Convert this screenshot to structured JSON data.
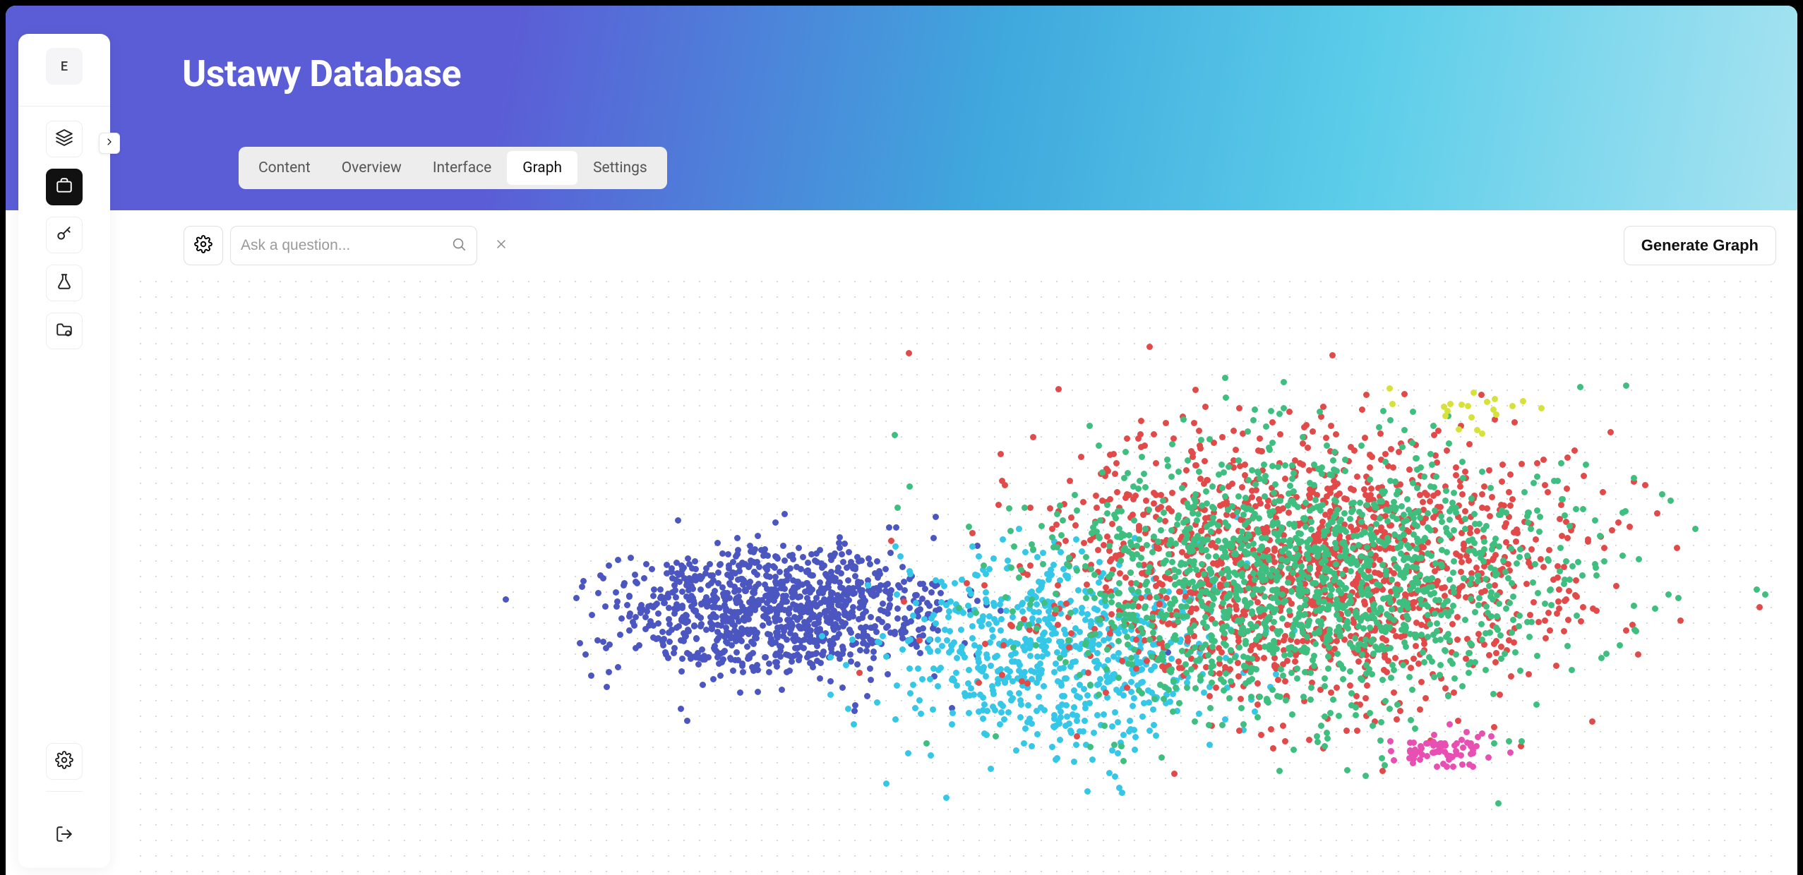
{
  "sidebar": {
    "avatar_initial": "E"
  },
  "header": {
    "title": "Ustawy Database"
  },
  "tabs": {
    "content": "Content",
    "overview": "Overview",
    "interface": "Interface",
    "graph": "Graph",
    "settings": "Settings",
    "active": "graph"
  },
  "search": {
    "placeholder": "Ask a question..."
  },
  "actions": {
    "generate_graph": "Generate Graph"
  },
  "chart_data": {
    "type": "scatter",
    "title": "",
    "xlabel": "",
    "ylabel": "",
    "description": "2D embedding scatter plot with ~5000 points forming two main clusters. Left dense blob is dark-blue (~1200 pts). Right larger mixed cluster of red, green and a cyan transition band (~3500 pts). Small magenta sub-cluster lower-right. Sparse yellow/lime outliers.",
    "clusters": [
      {
        "id": "darkblue",
        "color": "#4b56c0",
        "count": 1200,
        "center": [
          0.28,
          0.55
        ],
        "spread": [
          0.11,
          0.13
        ]
      },
      {
        "id": "cyan",
        "color": "#35c7e8",
        "count": 700,
        "center": [
          0.45,
          0.62
        ],
        "spread": [
          0.1,
          0.16
        ]
      },
      {
        "id": "red",
        "color": "#e24a4a",
        "count": 1500,
        "center": [
          0.6,
          0.48
        ],
        "spread": [
          0.16,
          0.22
        ]
      },
      {
        "id": "green",
        "color": "#3fbf7f",
        "count": 1500,
        "center": [
          0.6,
          0.5
        ],
        "spread": [
          0.16,
          0.22
        ]
      },
      {
        "id": "magenta",
        "color": "#e84fb3",
        "count": 70,
        "center": [
          0.68,
          0.78
        ],
        "spread": [
          0.03,
          0.03
        ]
      },
      {
        "id": "yellow",
        "color": "#d6e23a",
        "count": 20,
        "center": [
          0.7,
          0.22
        ],
        "spread": [
          0.04,
          0.04
        ]
      }
    ]
  }
}
